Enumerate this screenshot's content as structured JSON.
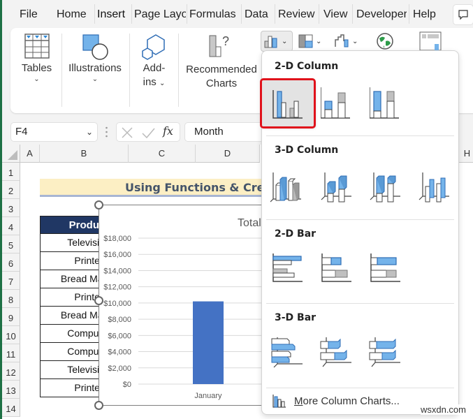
{
  "ribbon_tabs": [
    "File",
    "Home",
    "Insert",
    "Page Layout",
    "Formulas",
    "Data",
    "Review",
    "View",
    "Developer",
    "Help"
  ],
  "active_tab": "Insert",
  "ribbon_groups": {
    "tables": "Tables",
    "illustrations": "Illustrations",
    "addins_line1": "Add-",
    "addins_line2": "ins",
    "recommended_line1": "Recommended",
    "recommended_line2": "Charts"
  },
  "formula_bar": {
    "name_box": "F4",
    "cancel_icon": "x-icon",
    "enter_icon": "check-icon",
    "fx_label": "fx",
    "content": "Month"
  },
  "columns": [
    "A",
    "B",
    "C",
    "D",
    "H"
  ],
  "rows": [
    "1",
    "2",
    "3",
    "4",
    "5",
    "6",
    "7",
    "8",
    "9",
    "10",
    "11",
    "12",
    "13",
    "14"
  ],
  "sheet": {
    "title": "Using Functions & Creating a Chart",
    "table_header": "Product",
    "products": [
      "Television",
      "Printer",
      "Bread Maker",
      "Printer",
      "Bread Maker",
      "Computer",
      "Computer",
      "Television",
      "Printer"
    ]
  },
  "chart_data": {
    "type": "bar",
    "title": "Total",
    "categories": [
      "January"
    ],
    "values": [
      10200
    ],
    "xlabel": "",
    "ylabel": "",
    "ylim": [
      0,
      18000
    ],
    "yticks": [
      "$0",
      "$2,000",
      "$4,000",
      "$6,000",
      "$8,000",
      "$10,000",
      "$12,000",
      "$14,000",
      "$16,000",
      "$18,000"
    ],
    "grid": true,
    "bar_color": "#4472c4"
  },
  "gallery": {
    "sections": [
      {
        "title": "2-D Column",
        "items": [
          "Clustered Column",
          "Stacked Column",
          "100% Stacked Column"
        ]
      },
      {
        "title": "3-D Column",
        "items": [
          "3-D Clustered Column",
          "3-D Stacked Column",
          "3-D 100% Stacked Column",
          "3-D Column"
        ]
      },
      {
        "title": "2-D Bar",
        "items": [
          "Clustered Bar",
          "Stacked Bar",
          "100% Stacked Bar"
        ]
      },
      {
        "title": "3-D Bar",
        "items": [
          "3-D Clustered Bar",
          "3-D Stacked Bar",
          "3-D 100% Stacked Bar"
        ]
      }
    ],
    "selected_item": "Clustered Column",
    "more_label_prefix": "M",
    "more_label_rest": "ore Column Charts..."
  },
  "colors": {
    "accent_green": "#1e7145",
    "highlight_red": "#e0121b",
    "table_header_bg": "#203764",
    "title_band_bg": "#fcefc4",
    "icon_blue": "#74b3ea"
  },
  "watermark": "wsxdn.com"
}
